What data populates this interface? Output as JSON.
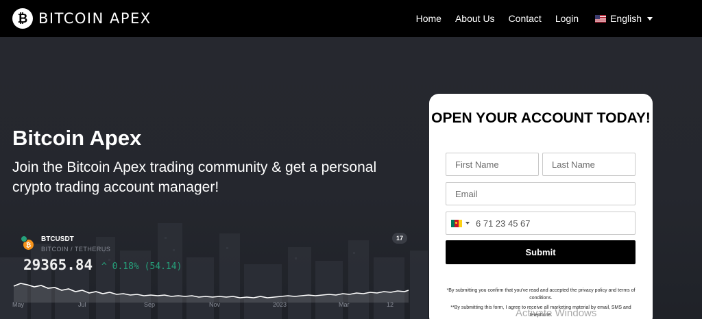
{
  "header": {
    "logo_mark": "₿",
    "logo_text": "BITCOIN APEX",
    "nav": [
      "Home",
      "About Us",
      "Contact",
      "Login"
    ],
    "language": "English"
  },
  "hero": {
    "title": "Bitcoin Apex",
    "subtitle": "Join the Bitcoin Apex trading community & get a personal crypto trading account manager!"
  },
  "ticker": {
    "coin_mark": "₿",
    "pair": "BTCUSDT",
    "pair_full": "BITCOIN / TETHERUS",
    "price": "29365.84",
    "change": "^ 0.18% (54.14)",
    "tv_label": "17",
    "months": [
      "May",
      "Jul",
      "Sep",
      "Nov",
      "2023",
      "Mar",
      "12"
    ],
    "colors": {
      "up": "#26a17b",
      "coin": "#f7931a"
    }
  },
  "form": {
    "title": "OPEN YOUR ACCOUNT TODAY!",
    "first_name_placeholder": "First Name",
    "last_name_placeholder": "Last Name",
    "email_placeholder": "Email",
    "phone_placeholder": "6 71 23 45 67",
    "submit_label": "Submit",
    "disclaimer_1": "*By submitting you confirm that you've read and accepted the privacy policy and terms of conditions.",
    "disclaimer_2": "**By submitting this form, I agree to receive all marketing material by email, SMS and telephone."
  },
  "watermark": "Activate Windows"
}
